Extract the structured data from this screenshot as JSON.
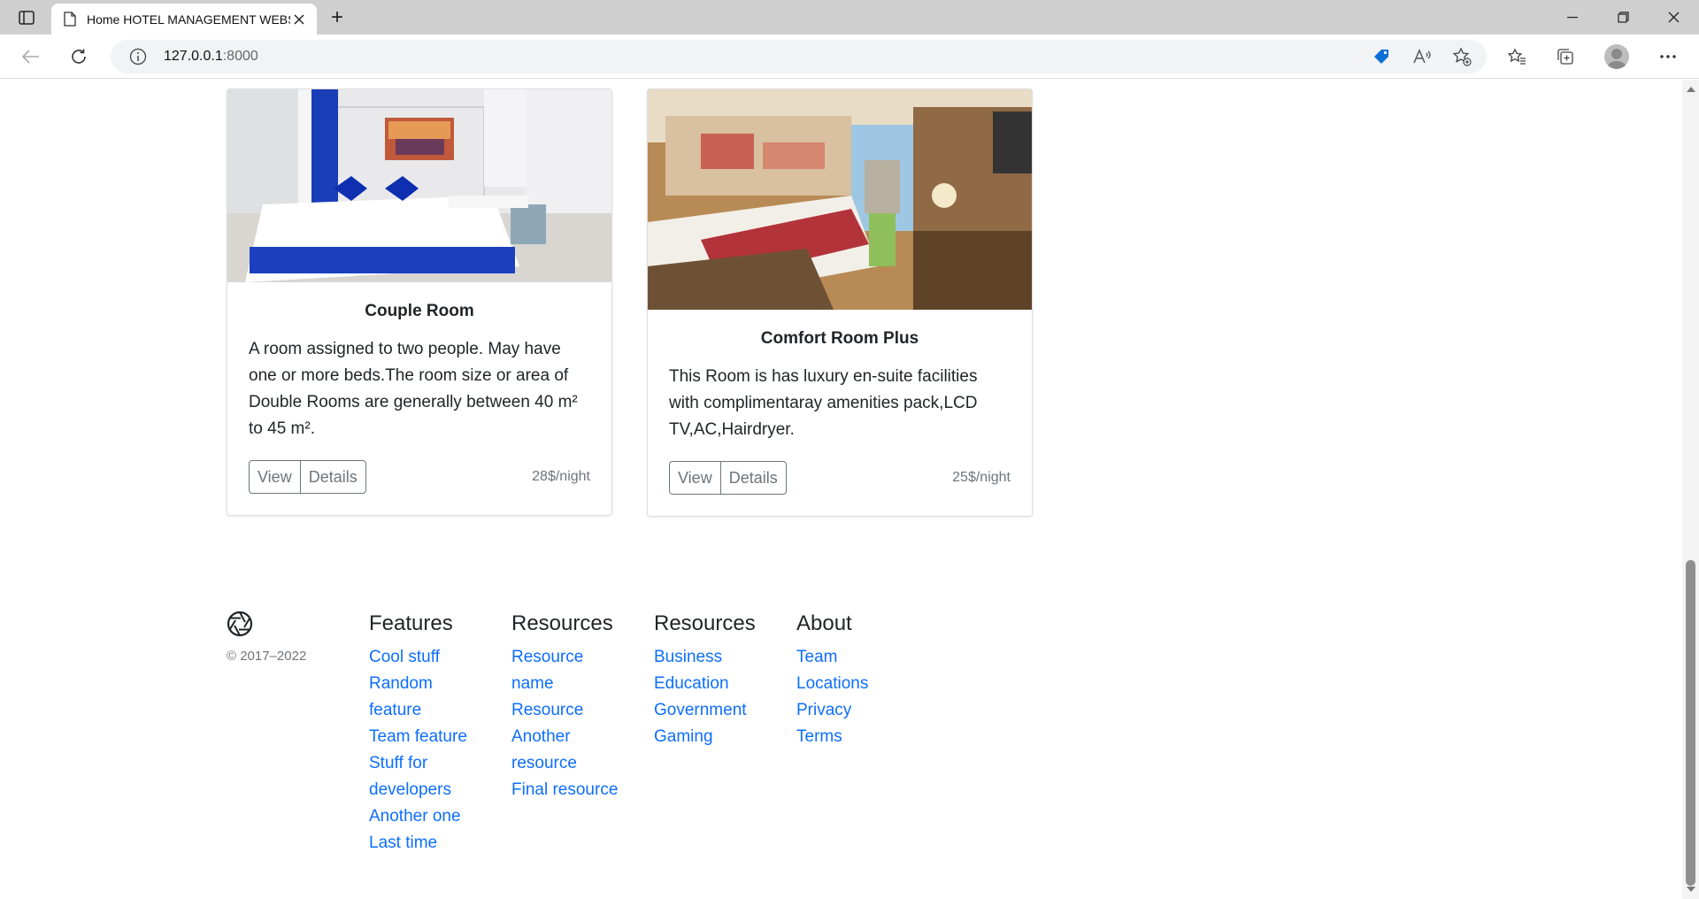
{
  "browser": {
    "tab_title": "Home HOTEL MANAGEMENT WEBSITE",
    "new_tab_symbol": "+",
    "url_host": "127.0.0.1",
    "url_port": ":8000"
  },
  "rooms": [
    {
      "title": "Couple Room",
      "description": "A room assigned to two people. May have one or more beds.The room size or area of Double Rooms are generally between 40 m² to 45 m².",
      "view_label": "View",
      "details_label": "Details",
      "price": "28$/night"
    },
    {
      "title": "Comfort Room Plus",
      "description": "This Room is has luxury en-suite facilities with complimentaray amenities pack,LCD TV,AC,Hairdryer.",
      "view_label": "View",
      "details_label": "Details",
      "price": "25$/night"
    }
  ],
  "footer": {
    "copyright": "© 2017–2022",
    "columns": [
      {
        "heading": "Features",
        "links": [
          "Cool stuff",
          "Random feature",
          "Team feature",
          "Stuff for developers",
          "Another one",
          "Last time"
        ]
      },
      {
        "heading": "Resources",
        "links": [
          "Resource name",
          "Resource",
          "Another resource",
          "Final resource"
        ]
      },
      {
        "heading": "Resources",
        "links": [
          "Business",
          "Education",
          "Government",
          "Gaming"
        ]
      },
      {
        "heading": "About",
        "links": [
          "Team",
          "Locations",
          "Privacy",
          "Terms"
        ]
      }
    ]
  },
  "colors": {
    "link": "#0d6efd",
    "muted": "#6c757d",
    "edge_tag": "#0b6fd6"
  }
}
